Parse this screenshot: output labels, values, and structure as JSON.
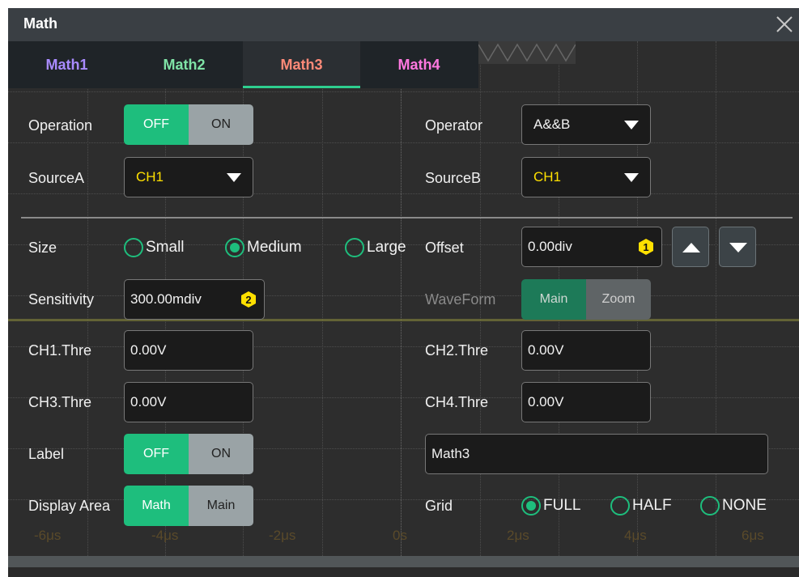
{
  "window": {
    "title": "Math"
  },
  "tabs": [
    {
      "label": "Math1",
      "color": "#a98bff"
    },
    {
      "label": "Math2",
      "color": "#7fe3a6"
    },
    {
      "label": "Math3",
      "color": "#ff8a78"
    },
    {
      "label": "Math4",
      "color": "#ff78e0"
    }
  ],
  "active_tab": "Math3",
  "left": {
    "operation": {
      "label": "Operation",
      "off": "OFF",
      "on": "ON",
      "state": "OFF"
    },
    "sourceA": {
      "label": "SourceA",
      "value": "CH1"
    },
    "size": {
      "label": "Size",
      "options": [
        "Small",
        "Medium",
        "Large"
      ],
      "selected": "Medium"
    },
    "sensitivity": {
      "label": "Sensitivity",
      "value": "300.00mdiv",
      "knob": "2"
    },
    "ch1": {
      "label": "CH1.Thre",
      "value": "0.00V"
    },
    "ch3": {
      "label": "CH3.Thre",
      "value": "0.00V"
    },
    "labelToggle": {
      "label": "Label",
      "off": "OFF",
      "on": "ON",
      "state": "OFF"
    },
    "displayArea": {
      "label": "Display Area",
      "opt1": "Math",
      "opt2": "Main",
      "state": "Math"
    }
  },
  "right": {
    "operator": {
      "label": "Operator",
      "value": "A&&B"
    },
    "sourceB": {
      "label": "SourceB",
      "value": "CH1"
    },
    "offset": {
      "label": "Offset",
      "value": "0.00div",
      "knob": "1"
    },
    "waveform": {
      "label": "WaveForm",
      "opt1": "Main",
      "opt2": "Zoom",
      "state": "Main"
    },
    "ch2": {
      "label": "CH2.Thre",
      "value": "0.00V"
    },
    "ch4": {
      "label": "CH4.Thre",
      "value": "0.00V"
    },
    "labelText": "Math3",
    "grid": {
      "label": "Grid",
      "options": [
        "FULL",
        "HALF",
        "NONE"
      ],
      "selected": "FULL"
    }
  },
  "axis": [
    "-6μs",
    "-4μs",
    "-2μs",
    "0s",
    "2μs",
    "4μs",
    "6μs"
  ],
  "colors": {
    "accent": "#1ebe7d",
    "badge": "#ffe000"
  },
  "icons": {
    "close": "close-icon",
    "trigger": "trigger-marker-icon",
    "knob": "multipurpose-knob-icon"
  }
}
